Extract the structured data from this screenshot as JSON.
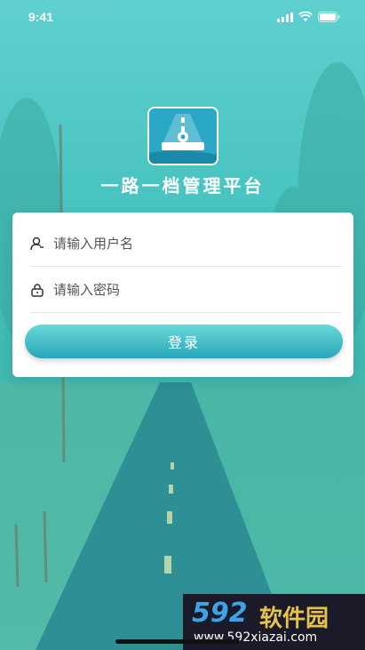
{
  "status_bar": {
    "time": "9:41"
  },
  "app": {
    "title": "一路一档管理平台"
  },
  "login_form": {
    "username_placeholder": "请输入用户名",
    "password_placeholder": "请输入密码",
    "login_label": "登录"
  },
  "watermark": {
    "brand_number": "592",
    "brand_text": "软件园",
    "url": "www.592xiazai.com"
  },
  "colors": {
    "accent": "#2aa8c5",
    "button_top": "#69d9d8",
    "button_bottom": "#27a6b7"
  }
}
